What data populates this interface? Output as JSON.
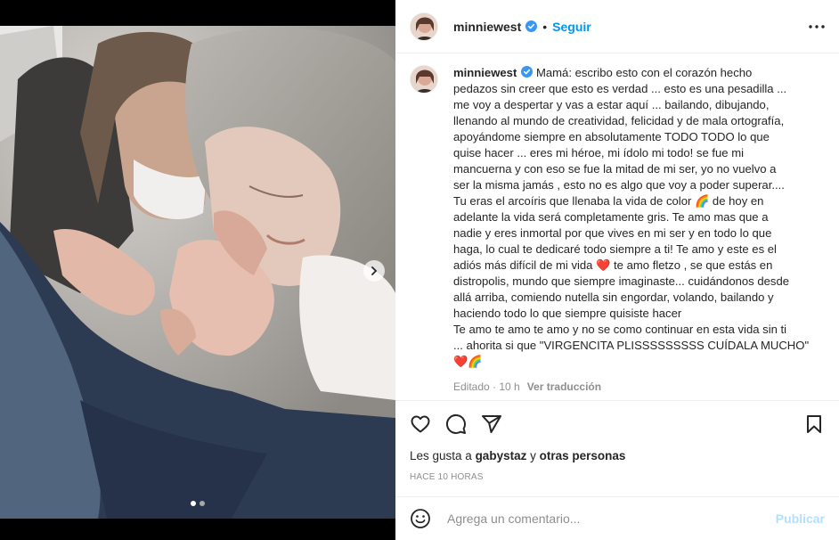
{
  "post": {
    "username": "minniewest",
    "follow_label": "Seguir",
    "separator": "•",
    "caption": {
      "username": "minniewest",
      "lines": [
        "Mamá: escribo esto con el corazón hecho",
        "pedazos sin creer que esto es verdad ... esto es una pesadilla ...",
        "me voy a despertar y vas a estar aquí ... bailando, dibujando,",
        "llenando al mundo de creatividad, felicidad y de mala ortografía,",
        "apoyándome siempre en absolutamente TODO TODO lo que",
        "quise hacer ... eres mi héroe, mi ídolo mi todo! se fue mi",
        "mancuerna y con eso se fue la mitad de mi ser, yo no vuelvo a",
        "ser la misma jamás , esto no es algo que voy a poder superar....",
        "Tu eras el arcoíris que llenaba la vida de color 🌈 de hoy en",
        "adelante la vida será completamente gris. Te amo mas que a",
        "nadie y eres inmortal por que vives en mi ser y en todo lo que",
        "haga, lo cual te dedicaré todo siempre a ti! Te amo y este es el",
        "adiós más difícil de mi vida ❤️ te amo fletzo , se que estás en",
        "distropolis, mundo que siempre imaginaste... cuidándonos desde",
        "allá arriba, comiendo nutella sin engordar, volando, bailando y",
        "haciendo todo lo que siempre quisiste hacer",
        "Te amo te amo te amo y no se como continuar en esta vida sin ti",
        "... ahorita si que \"VIRGENCITA PLISSSSSSSSS CUÍDALA MUCHO\"",
        "❤️🌈"
      ]
    },
    "edited_label": "Editado · 10 h",
    "translate_label": "Ver traducción",
    "likes": {
      "prefix": "Les gusta a ",
      "user": "gabystaz",
      "middle": " y ",
      "others": "otras personas"
    },
    "timestamp": "HACE 10 HORAS",
    "comment_placeholder": "Agrega un comentario...",
    "publish_label": "Publicar"
  },
  "carousel": {
    "current": 1,
    "total": 2
  },
  "icons": {
    "verified": "verified-badge-icon",
    "more": "more-options-icon",
    "like": "heart-icon",
    "comment": "comment-bubble-icon",
    "share": "paper-plane-icon",
    "save": "bookmark-icon",
    "emoji": "emoji-smile-icon",
    "next": "chevron-right-icon"
  },
  "colors": {
    "accent": "#0095f6",
    "verified": "#3897f0",
    "publish_disabled": "#b2dffc",
    "muted": "#8e8e8e"
  }
}
